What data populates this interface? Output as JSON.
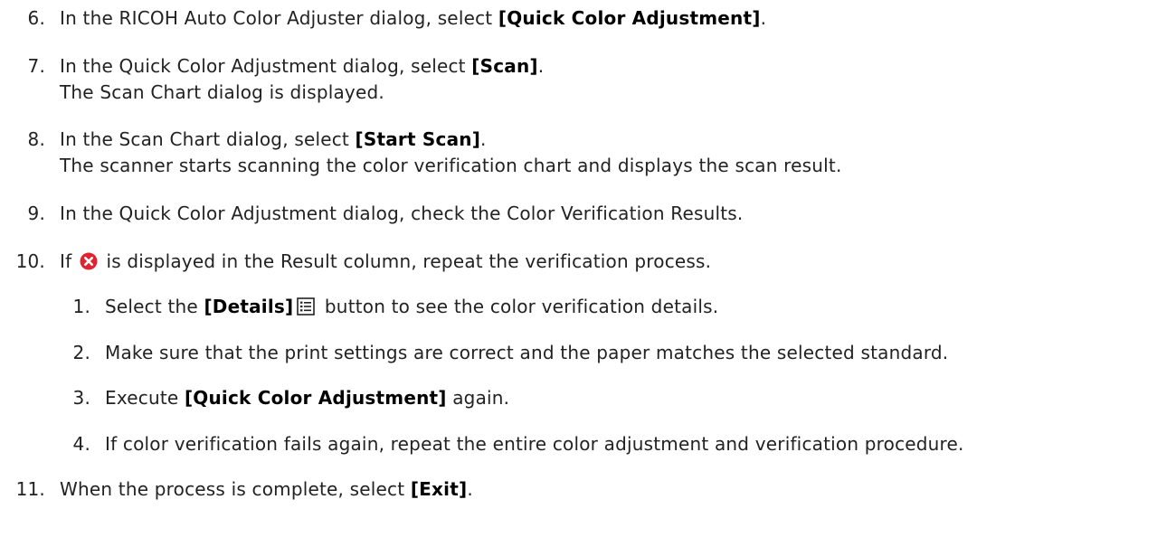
{
  "steps": [
    {
      "number": "6.",
      "pre": "In the RICOH Auto Color Adjuster dialog, select ",
      "bold": "[Quick Color Adjustment]",
      "post": "."
    },
    {
      "number": "7.",
      "pre": "In the Quick Color Adjustment dialog, select ",
      "bold": "[Scan]",
      "post": ".",
      "line2": "The Scan Chart dialog is displayed."
    },
    {
      "number": "8.",
      "pre": "In the Scan Chart dialog, select ",
      "bold": "[Start Scan]",
      "post": ".",
      "line2": "The scanner starts scanning the color verification chart and displays the scan result."
    },
    {
      "number": "9.",
      "text": "In the Quick Color Adjustment dialog, check the Color Verification Results."
    },
    {
      "number": "10.",
      "pre": "If ",
      "icon": "error-circle-icon",
      "post": " is displayed in the Result column, repeat the verification process.",
      "substeps": [
        {
          "number": "1.",
          "pre": "Select the ",
          "bold": "[Details]",
          "icon": "details-list-icon",
          "post": " button to see the color verification details."
        },
        {
          "number": "2.",
          "text": "Make sure that the print settings are correct and the paper matches the selected standard."
        },
        {
          "number": "3.",
          "pre": "Execute ",
          "bold": "[Quick Color Adjustment]",
          "post": " again."
        },
        {
          "number": "4.",
          "text": "If color verification fails again, repeat the entire color adjustment and verification procedure."
        }
      ]
    },
    {
      "number": "11.",
      "pre": "When the process is complete, select ",
      "bold": "[Exit]",
      "post": "."
    }
  ],
  "colors": {
    "error_icon": "#e2232f",
    "text": "#222222"
  }
}
